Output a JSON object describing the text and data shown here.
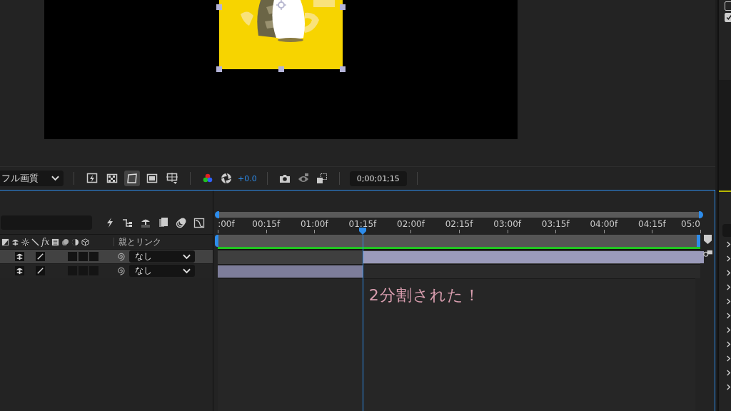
{
  "right_panel": {
    "checkboxes": [
      {
        "checked": false
      },
      {
        "checked": true
      }
    ],
    "expanders": [
      {
        "expanded": false
      },
      {
        "expanded": false
      },
      {
        "expanded": false
      },
      {
        "expanded": false
      },
      {
        "expanded": false
      },
      {
        "expanded": false
      },
      {
        "expanded": false
      },
      {
        "expanded": false
      },
      {
        "expanded": false
      },
      {
        "expanded": false
      },
      {
        "expanded": false
      }
    ]
  },
  "viewer_toolbar": {
    "quality": "フル画質",
    "view_buttons": [
      {
        "kind": "fast_preview",
        "selected": false
      },
      {
        "kind": "transparency",
        "selected": false
      },
      {
        "kind": "mask_path",
        "selected": true
      },
      {
        "kind": "region",
        "selected": false
      },
      {
        "kind": "guides",
        "selected": false
      }
    ],
    "exposure": "+0.0",
    "timecode": "0;00;01;15"
  },
  "timeline": {
    "tools": [
      {
        "kind": "bolt"
      },
      {
        "kind": "tree"
      },
      {
        "kind": "shy"
      },
      {
        "kind": "frames"
      },
      {
        "kind": "motion_blur"
      },
      {
        "kind": "graph"
      }
    ],
    "header_icons": [
      {
        "kind": "label"
      },
      {
        "kind": "shy"
      },
      {
        "kind": "sun"
      },
      {
        "kind": "slash"
      },
      {
        "kind": "fx",
        "text": "fx"
      },
      {
        "kind": "frames"
      },
      {
        "kind": "motion_blur"
      },
      {
        "kind": "adjust"
      },
      {
        "kind": "cube"
      }
    ],
    "parent_header": "親とリンク",
    "layers": [
      {
        "selected": true,
        "parent": "なし",
        "from_playhead": true
      },
      {
        "selected": false,
        "parent": "なし",
        "from_playhead": false
      }
    ],
    "ruler": [
      ":00f",
      "00:15f",
      "01:00f",
      "01:15f",
      "02:00f",
      "02:15f",
      "03:00f",
      "03:15f",
      "04:00f",
      "04:15f",
      "05:0"
    ],
    "playhead": {
      "level": 0.3
    },
    "note": "2分割された！"
  }
}
